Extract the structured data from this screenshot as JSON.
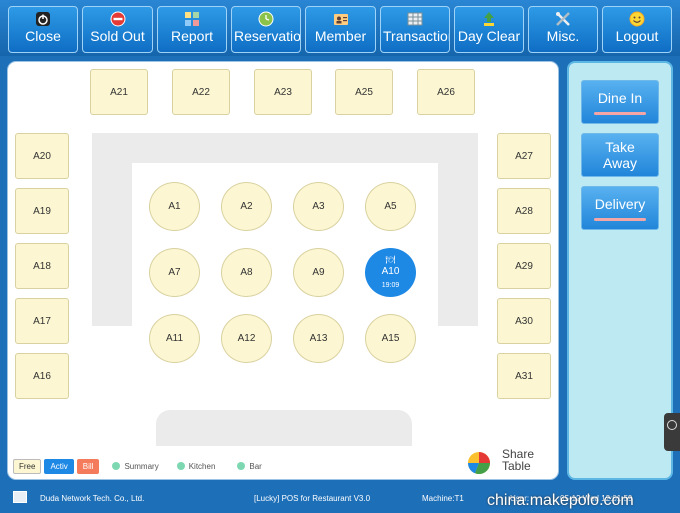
{
  "toolbar": {
    "buttons": [
      {
        "label": "Close",
        "icon": "power-icon"
      },
      {
        "label": "Sold Out",
        "icon": "no-entry-icon"
      },
      {
        "label": "Report",
        "icon": "grid-report-icon"
      },
      {
        "label": "Reservation",
        "icon": "clock-icon"
      },
      {
        "label": "Member",
        "icon": "member-card-icon"
      },
      {
        "label": "Transaction",
        "icon": "table-icon"
      },
      {
        "label": "Day Clear",
        "icon": "recycle-icon"
      },
      {
        "label": "Misc.",
        "icon": "tools-icon"
      },
      {
        "label": "Logout",
        "icon": "smiley-icon"
      }
    ]
  },
  "tables": {
    "top": [
      "A21",
      "A22",
      "A23",
      "A25",
      "A26"
    ],
    "left": [
      "A20",
      "A19",
      "A18",
      "A17",
      "A16"
    ],
    "right": [
      "A27",
      "A28",
      "A29",
      "A30",
      "A31"
    ],
    "round": [
      [
        "A1",
        "A2",
        "A3",
        "A5"
      ],
      [
        "A7",
        "A8",
        "A9",
        "A10"
      ],
      [
        "A11",
        "A12",
        "A13",
        "A15"
      ]
    ],
    "active_table": {
      "name": "A10",
      "time": "19:09",
      "icon": "plate-icon"
    }
  },
  "legend": {
    "free": "Free",
    "active": "Activ",
    "bill": "Bill",
    "summary": "Summary",
    "kitchen": "Kitchen",
    "bar": "Bar",
    "share_table": "Share Table"
  },
  "side": {
    "dine_in": "Dine In",
    "take_away": "Take Away",
    "delivery": "Delivery"
  },
  "status": {
    "company": "Duda Network Tech. Co., Ltd.",
    "product": "[Lucky] POS for Restaurant V3.0",
    "machine": "Machine:T1",
    "user": "User:",
    "datetime": "05-12 Wed 12:01:59"
  },
  "watermark": "china.makepolo.com",
  "colors": {
    "toolbar": "#1565ac",
    "free_table": "#fcf7d2",
    "active_table": "#1e88e5",
    "bill": "#f47b5b",
    "side_panel": "#bde9f2"
  }
}
